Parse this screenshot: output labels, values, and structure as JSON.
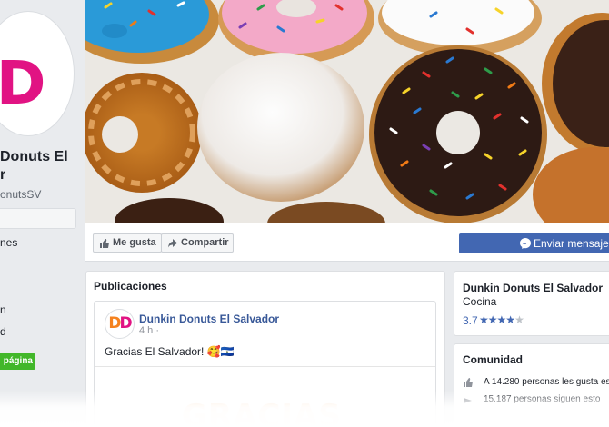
{
  "page": {
    "name": "Donuts El\nr",
    "handle": "onutsSV",
    "logo_text": "DD"
  },
  "sidebar": {
    "items": [
      "nes",
      "n",
      "d"
    ],
    "create_page_label": "página"
  },
  "actions": {
    "like_label": "Me gusta",
    "share_label": "Compartir",
    "send_message_label": "Enviar mensaje"
  },
  "posts": {
    "title": "Publicaciones",
    "items": [
      {
        "author": "Dunkin Donuts El Salvador",
        "time": "4 h ·",
        "text": "Gracias El Salvador! 🥰🇸🇻",
        "image_text": "GRACIAS"
      }
    ]
  },
  "about": {
    "name": "Dunkin Donuts El Salvador",
    "category": "Cocina",
    "rating": "3.7",
    "stars_filled": 3.7,
    "stars_total": 5
  },
  "community": {
    "title": "Comunidad",
    "likes_text": "A 14.280 personas les gusta es",
    "follows_text": "15.187 personas siguen esto"
  },
  "colors": {
    "facebook_blue": "#4267b2",
    "link_blue": "#385898",
    "brand_orange": "#f5821f",
    "brand_pink": "#e11383",
    "create_green": "#42b72a"
  }
}
